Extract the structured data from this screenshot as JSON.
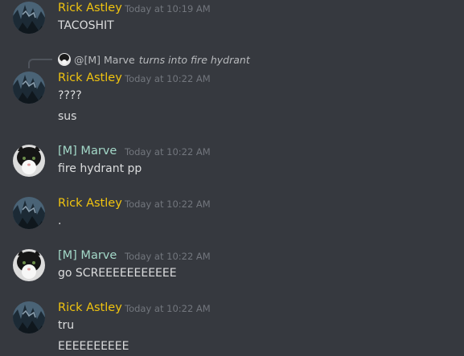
{
  "colors": {
    "background": "#36393f",
    "rick": "#f1c40f",
    "marve": "#a3d8c8",
    "text": "#dcddde",
    "timestamp": "#72767d"
  },
  "reply": {
    "author": "@[M] Marve",
    "text": "turns into fire hydrant"
  },
  "messages": [
    {
      "author": "Rick Astley",
      "time": "Today at 10:19 AM",
      "lines": [
        "TACOSHIT"
      ]
    },
    {
      "author": "Rick Astley",
      "time": "Today at 10:22 AM",
      "lines": [
        "????",
        "sus"
      ]
    },
    {
      "author": "[M] Marve",
      "time": "Today at 10:22 AM",
      "lines": [
        "fire hydrant pp"
      ]
    },
    {
      "author": "Rick Astley",
      "time": "Today at 10:22 AM",
      "lines": [
        "."
      ]
    },
    {
      "author": "[M] Marve",
      "time": "Today at 10:22 AM",
      "lines": [
        "go SCREEEEEEEEEEE"
      ]
    },
    {
      "author": "Rick Astley",
      "time": "Today at 10:22 AM",
      "lines": [
        "tru",
        "EEEEEEEEEE"
      ]
    }
  ]
}
